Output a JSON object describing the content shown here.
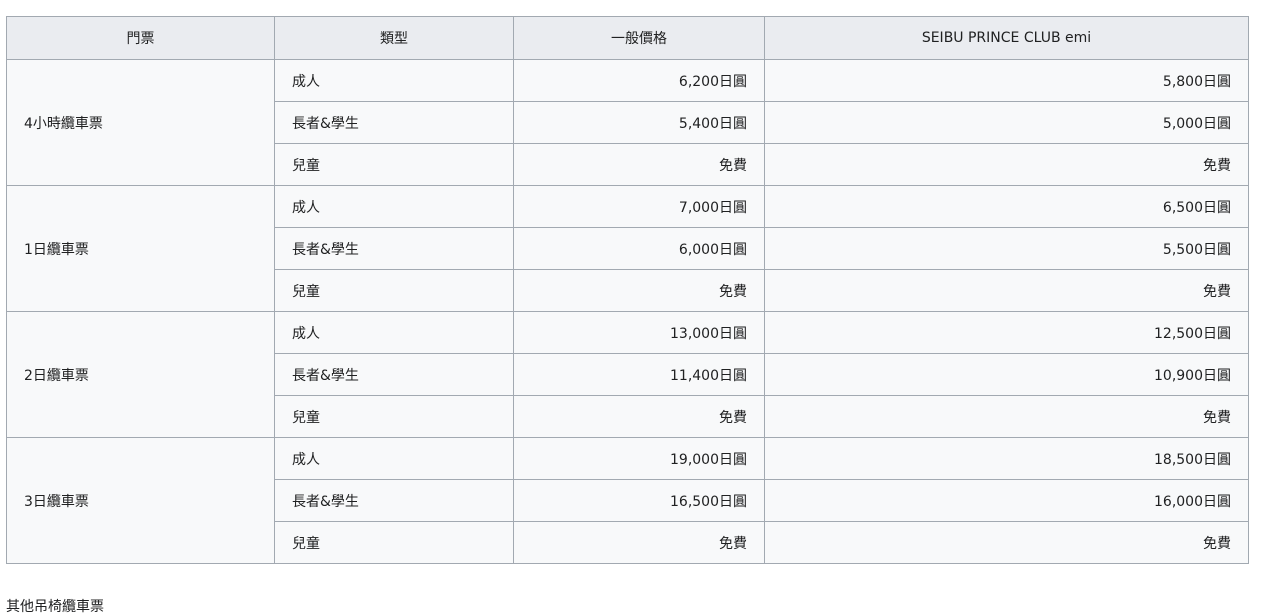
{
  "table": {
    "headers": [
      "門票",
      "類型",
      "一般價格",
      "SEIBU PRINCE CLUB emi"
    ],
    "groups": [
      {
        "ticket": "4小時纜車票",
        "rows": [
          {
            "type": "成人",
            "general": "6,200日圓",
            "member": "5,800日圓"
          },
          {
            "type": "長者&學生",
            "general": "5,400日圓",
            "member": "5,000日圓"
          },
          {
            "type": "兒童",
            "general": "免費",
            "member": "免費"
          }
        ]
      },
      {
        "ticket": "1日纜車票",
        "rows": [
          {
            "type": "成人",
            "general": "7,000日圓",
            "member": "6,500日圓"
          },
          {
            "type": "長者&學生",
            "general": "6,000日圓",
            "member": "5,500日圓"
          },
          {
            "type": "兒童",
            "general": "免費",
            "member": "免費"
          }
        ]
      },
      {
        "ticket": "2日纜車票",
        "rows": [
          {
            "type": "成人",
            "general": "13,000日圓",
            "member": "12,500日圓"
          },
          {
            "type": "長者&學生",
            "general": "11,400日圓",
            "member": "10,900日圓"
          },
          {
            "type": "兒童",
            "general": "免費",
            "member": "免費"
          }
        ]
      },
      {
        "ticket": "3日纜車票",
        "rows": [
          {
            "type": "成人",
            "general": "19,000日圓",
            "member": "18,500日圓"
          },
          {
            "type": "長者&學生",
            "general": "16,500日圓",
            "member": "16,000日圓"
          },
          {
            "type": "兒童",
            "general": "免費",
            "member": "免費"
          }
        ]
      }
    ]
  },
  "footer": {
    "text": "其他吊椅纜車票"
  }
}
